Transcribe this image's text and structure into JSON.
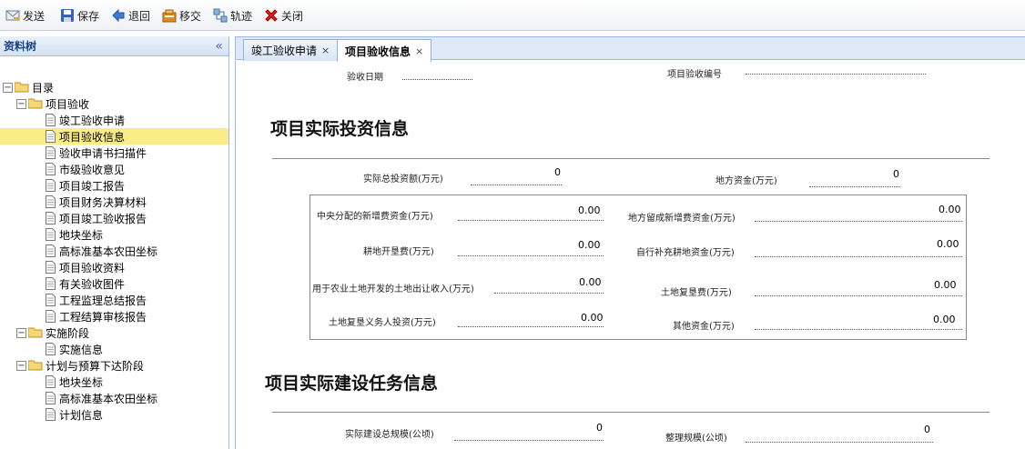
{
  "toolbar": {
    "send": "发送",
    "save": "保存",
    "back": "退回",
    "transfer": "移交",
    "track": "轨迹",
    "close": "关闭"
  },
  "sidebar": {
    "title": "资料树",
    "tree": [
      {
        "label": "目录"
      },
      {
        "label": "项目验收"
      },
      {
        "label": "竣工验收申请"
      },
      {
        "label": "项目验收信息"
      },
      {
        "label": "验收申请书扫描件"
      },
      {
        "label": "市级验收意见"
      },
      {
        "label": "项目竣工报告"
      },
      {
        "label": "项目财务决算材料"
      },
      {
        "label": "项目竣工验收报告"
      },
      {
        "label": "地块坐标"
      },
      {
        "label": "高标准基本农田坐标"
      },
      {
        "label": "项目验收资料"
      },
      {
        "label": "有关验收图件"
      },
      {
        "label": "工程监理总结报告"
      },
      {
        "label": "工程结算审核报告"
      },
      {
        "label": "实施阶段"
      },
      {
        "label": "实施信息"
      },
      {
        "label": "计划与预算下达阶段"
      },
      {
        "label": "地块坐标"
      },
      {
        "label": "高标准基本农田坐标"
      },
      {
        "label": "计划信息"
      }
    ]
  },
  "tabs": [
    {
      "label": "竣工验收申请",
      "close": "×"
    },
    {
      "label": "项目验收信息",
      "close": "×"
    }
  ],
  "form": {
    "acceptance_date_label": "验收日期",
    "acceptance_no_label": "项目验收编号",
    "section1_title": "项目实际投资信息",
    "total_invest_label": "实际总投资额(万元)",
    "total_invest_value": "0",
    "local_fund_label": "地方资金(万元)",
    "local_fund_value": "0",
    "central_fund_label": "中央分配的新增费资金(万元)",
    "central_fund_value": "0.00",
    "local_retained_label": "地方留成新增费资金(万元)",
    "local_retained_value": "0.00",
    "farmland_dev_label": "耕地开垦费(万元)",
    "farmland_dev_value": "0.00",
    "self_supplement_label": "自行补充耕地资金(万元)",
    "self_supplement_value": "0.00",
    "land_transfer_label": "用于农业土地开发的土地出让收入(万元)",
    "land_transfer_value": "0.00",
    "reclaim_fee_label": "土地复垦费(万元)",
    "reclaim_fee_value": "0.00",
    "reclaim_obligor_label": "土地复垦义务人投资(万元)",
    "reclaim_obligor_value": "0.00",
    "other_fund_label": "其他资金(万元)",
    "other_fund_value": "0.00",
    "section2_title": "项目实际建设任务信息",
    "total_scale_label": "实际建设总规模(公顷)",
    "total_scale_value": "0",
    "rearrange_scale_label": "整理规模(公顷)",
    "rearrange_scale_value": "0"
  }
}
